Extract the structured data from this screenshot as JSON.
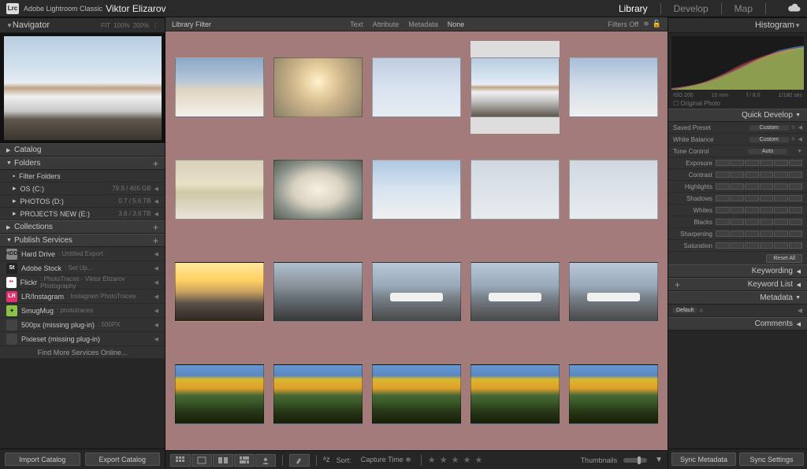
{
  "app": {
    "name": "Adobe Lightroom Classic",
    "logo": "Lrc",
    "user": "Viktor Elizarov"
  },
  "modules": {
    "library": "Library",
    "develop": "Develop",
    "map": "Map"
  },
  "navigator": {
    "title": "Navigator",
    "fit": "FIT",
    "p100": "100%",
    "p200": "200%"
  },
  "left_sections": {
    "catalog": "Catalog",
    "folders": "Folders",
    "collections": "Collections",
    "publish": "Publish Services"
  },
  "folders": {
    "filter": "Filter Folders",
    "drives": [
      {
        "name": "OS (C:)",
        "meta": "79.9 / 465 GB"
      },
      {
        "name": "PHOTOS (D:)",
        "meta": "0.7 / 5.6 TB"
      },
      {
        "name": "PROJECTS NEW (E:)",
        "meta": "3.6 / 3.6 TB"
      }
    ]
  },
  "publish": {
    "items": [
      {
        "icon_bg": "#888",
        "icon_txt": "HDD",
        "name": "Hard Drive",
        "sub": "Untitled Export"
      },
      {
        "icon_bg": "#222",
        "icon_txt": "St",
        "icon_color": "#fff",
        "name": "Adobe Stock",
        "sub": "Set Up..."
      },
      {
        "icon_bg": "#fff",
        "icon_txt": "••",
        "icon_color": "#f06",
        "name": "Flickr",
        "sub": "PhotoTraces - Viktor Elizarov Photography"
      },
      {
        "icon_bg": "#e1306c",
        "icon_txt": "LR",
        "icon_color": "#fff",
        "name": "LR/Instagram",
        "sub": "Instagram PhotoTraces"
      },
      {
        "icon_bg": "#8bc34a",
        "icon_txt": "✦",
        "icon_color": "#222",
        "name": "SmugMug",
        "sub": "phototraces"
      },
      {
        "icon_bg": "#444",
        "icon_txt": "",
        "name": "500px (missing plug-in)",
        "sub": "500PX"
      },
      {
        "icon_bg": "#444",
        "icon_txt": "",
        "name": "Pixieset (missing plug-in)",
        "sub": ""
      }
    ],
    "more": "Find More Services Online..."
  },
  "left_buttons": {
    "import": "Import Catalog",
    "export": "Export Catalog"
  },
  "filterbar": {
    "label": "Library Filter",
    "text": "Text",
    "attribute": "Attribute",
    "metadata": "Metadata",
    "none": "None",
    "filters_off": "Filters Off"
  },
  "toolbar": {
    "sort_label": "Sort:",
    "sort_value": "Capture Time",
    "thumbnails": "Thumbnails"
  },
  "histogram": {
    "title": "Histogram",
    "iso": "ISO 200",
    "focal": "10 mm",
    "aperture": "f / 8.0",
    "shutter": "1/180 sec",
    "original": "Original Photo"
  },
  "quick_develop": {
    "title": "Quick Develop",
    "saved_preset": "Saved Preset",
    "saved_preset_val": "Custom",
    "white_balance": "White Balance",
    "white_balance_val": "Custom",
    "tone_control": "Tone Control",
    "auto": "Auto",
    "sliders": [
      "Exposure",
      "Contrast",
      "Highlights",
      "Shadows",
      "Whites",
      "Blacks",
      "Sharpening",
      "Saturation"
    ],
    "reset": "Reset All"
  },
  "right_sections": {
    "keywording": "Keywording",
    "keyword_list": "Keyword List",
    "metadata": "Metadata",
    "comments": "Comments"
  },
  "metadata_row": {
    "preset": "Default"
  },
  "right_buttons": {
    "sync_meta": "Sync Metadata",
    "sync_settings": "Sync Settings"
  },
  "thumbs": [
    "t1",
    "t2",
    "t3",
    "t4",
    "t5",
    "t6",
    "t7",
    "t8",
    "t9",
    "t9",
    "t10",
    "t11",
    "t12",
    "t13",
    "t14",
    "t15",
    "t16",
    "t17",
    "t18",
    "t19"
  ],
  "selected_index": 3
}
